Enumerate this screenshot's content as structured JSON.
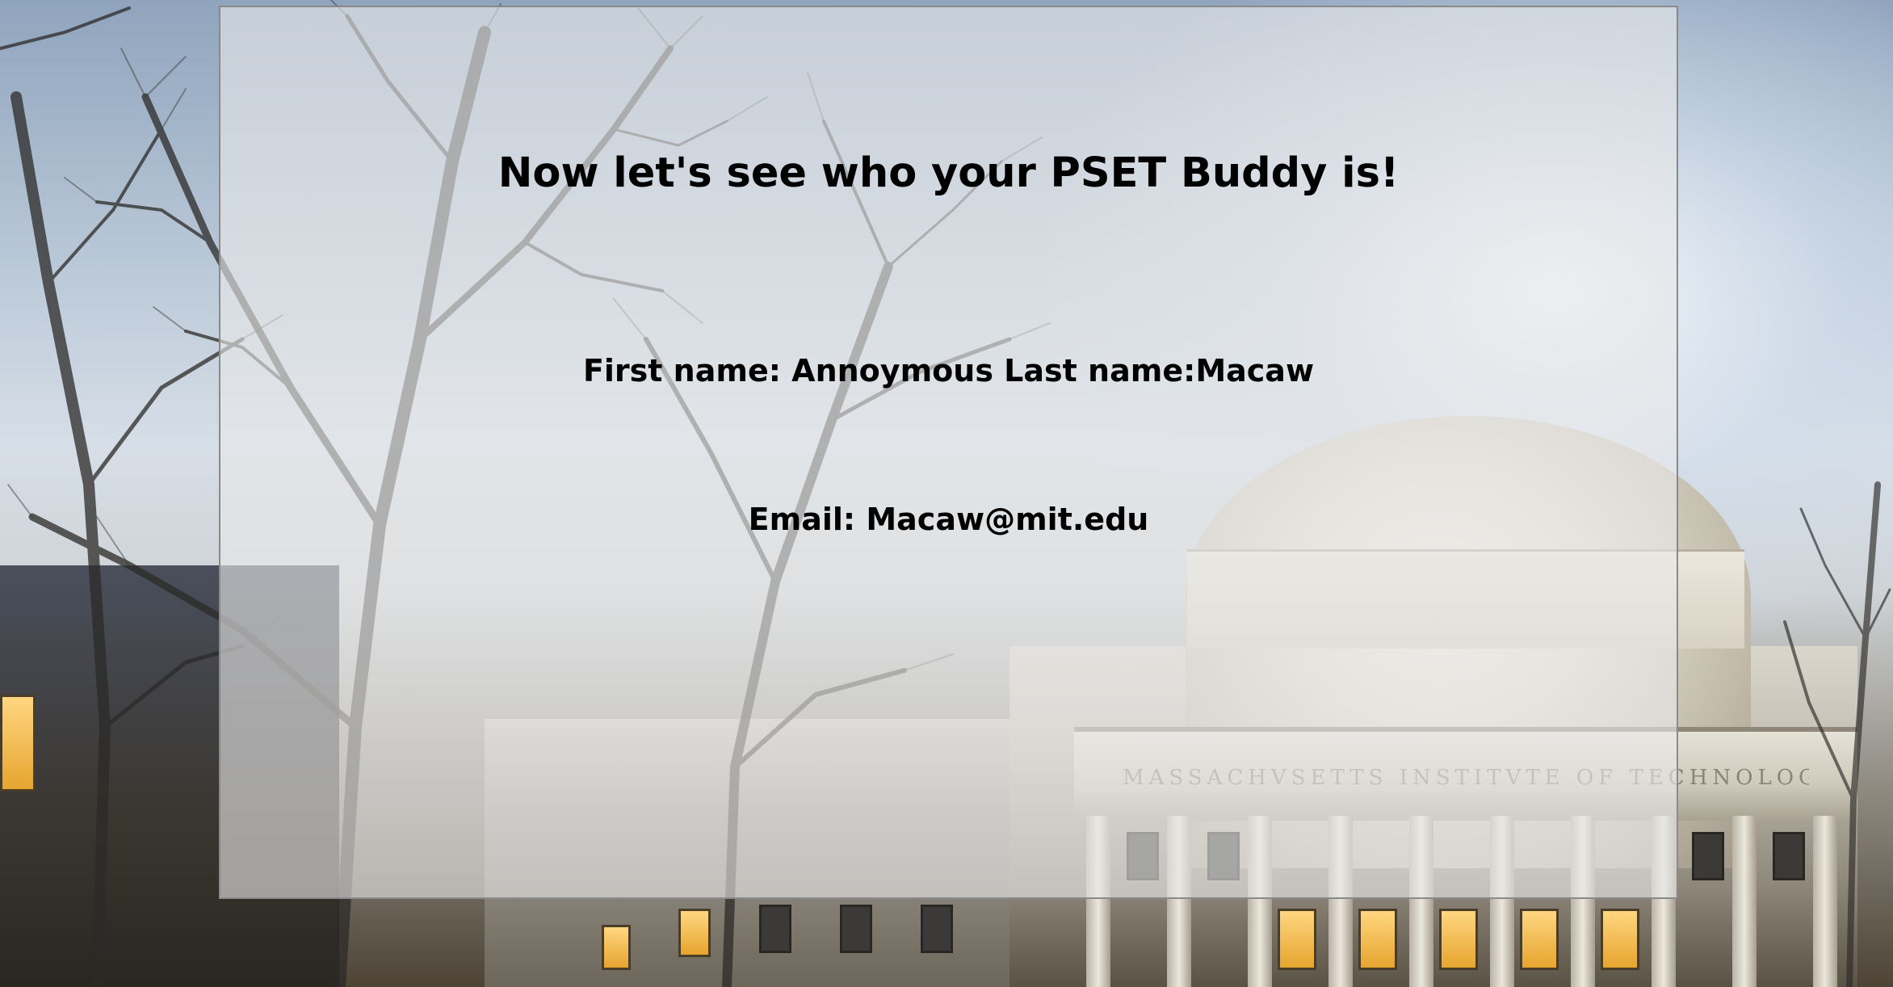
{
  "page": {
    "heading": "Now let's see who your PSET Buddy is!",
    "first_name_label": "First name:",
    "first_name_value": "Annoymous",
    "last_name_label": "Last name:",
    "last_name_value": "Macaw",
    "email_label": "Email:",
    "email_value": "Macaw@mit.edu"
  },
  "background": {
    "inscription": "MASSACHVSETTS INSTITVTE OF TECHNOLOGY"
  }
}
